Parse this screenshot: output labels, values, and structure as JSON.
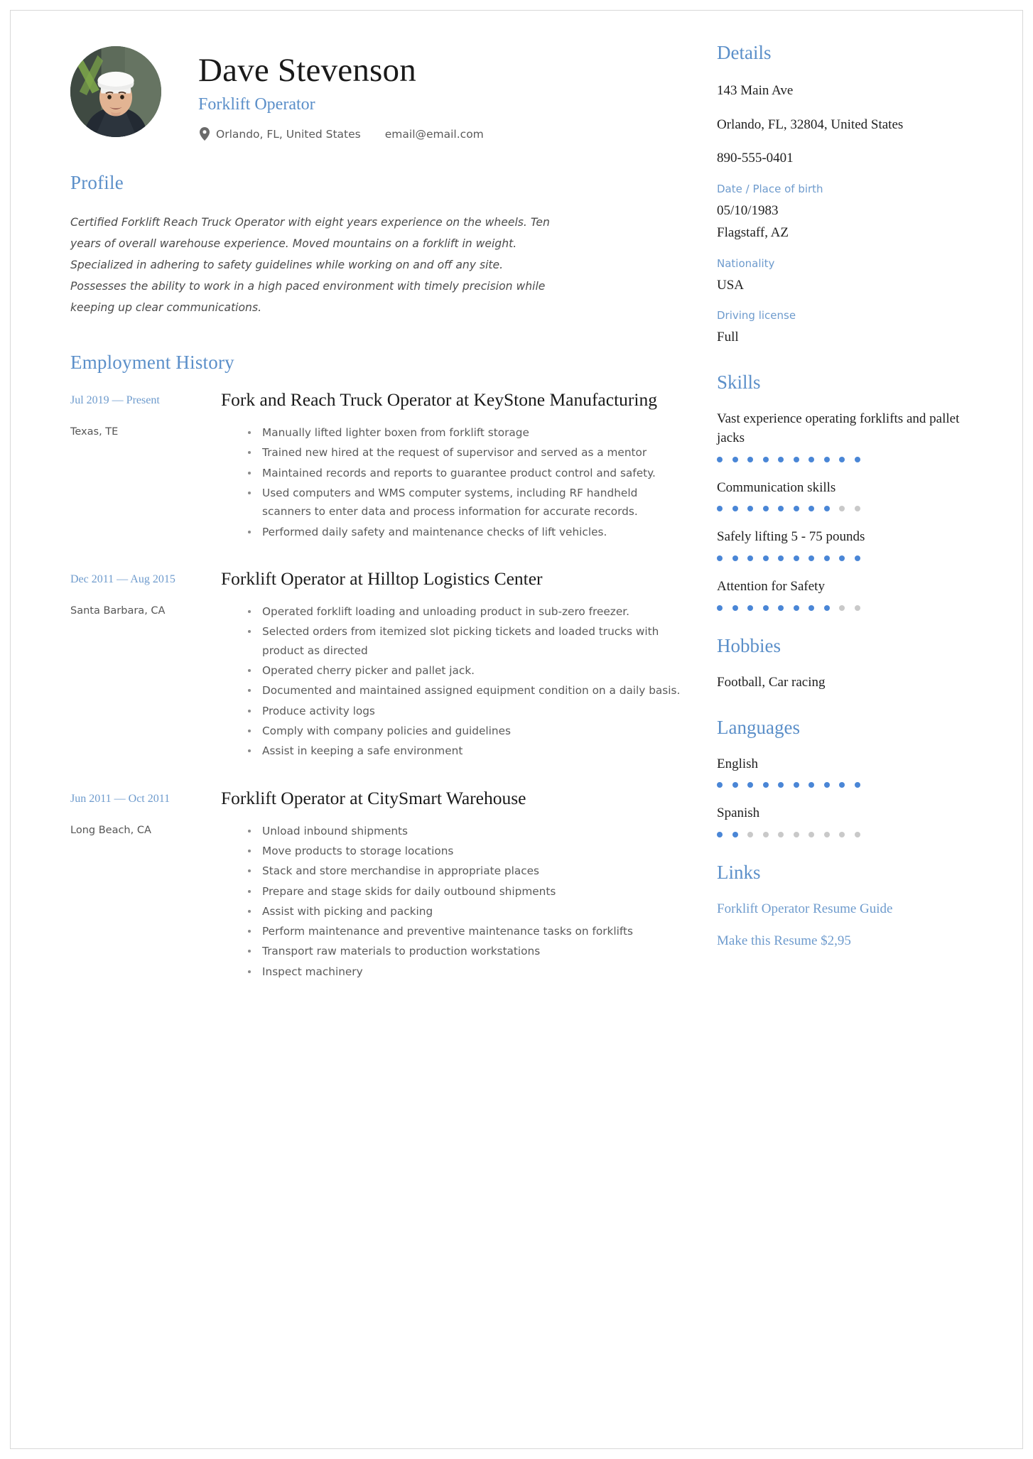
{
  "header": {
    "full_name": "Dave Stevenson",
    "job_title": "Forklift Operator",
    "location": "Orlando, FL, United States",
    "email": "email@email.com",
    "location_icon": "map-pin-icon",
    "avatar_alt": "portrait-photo"
  },
  "profile": {
    "heading": "Profile",
    "text": "Certified Forklift Reach Truck Operator with eight years experience on the wheels. Ten years of overall warehouse experience. Moved mountains on a forklift in weight. Specialized in adhering to safety guidelines while working on and off any site. Possesses the ability to work in a high paced environment with timely precision while keeping up clear communications."
  },
  "employment": {
    "heading": "Employment History",
    "jobs": [
      {
        "dates": "Jul 2019 — Present",
        "place": "Texas, TE",
        "role": "Fork and Reach Truck Operator at  KeyStone Manufacturing",
        "bullets": [
          "Manually lifted lighter boxen from forklift storage",
          "Trained new hired at the request of supervisor and served as a mentor",
          "Maintained records and reports to guarantee product control and safety.",
          "Used computers and WMS computer systems, including RF handheld scanners to enter data and process information for accurate records.",
          "Performed daily safety and maintenance checks of lift vehicles."
        ]
      },
      {
        "dates": "Dec 2011 — Aug 2015",
        "place": "Santa Barbara, CA",
        "role": "Forklift Operator at  Hilltop Logistics Center",
        "bullets": [
          "Operated forklift loading and unloading product in sub-zero freezer.",
          "Selected orders from itemized slot picking tickets and loaded trucks with product as directed",
          "Operated cherry picker and pallet jack.",
          "Documented and maintained assigned equipment condition on a daily basis.",
          "Produce activity logs",
          "Comply with company policies and guidelines",
          "Assist in keeping a safe environment"
        ]
      },
      {
        "dates": "Jun 2011 — Oct 2011",
        "place": "Long Beach, CA",
        "role": "Forklift Operator at  CitySmart Warehouse",
        "bullets": [
          "Unload inbound shipments",
          "Move products to storage locations",
          "Stack and store merchandise in appropriate places",
          "Prepare and stage skids for daily outbound shipments",
          "Assist with picking and packing",
          "Perform maintenance and preventive maintenance tasks on forklifts",
          "Transport raw materials to production workstations",
          "Inspect machinery"
        ]
      }
    ]
  },
  "details": {
    "heading": "Details",
    "address": "143 Main Ave",
    "city_line": "Orlando, FL, 32804, United States",
    "phone": "890-555-0401",
    "birth_label": "Date / Place of birth",
    "birth_value": "05/10/1983 Flagstaff, AZ",
    "birth_date": "05/10/1983",
    "birth_place": "Flagstaff, AZ",
    "nationality_label": "Nationality",
    "nationality_value": "USA",
    "license_label": "Driving license",
    "license_value": "Full"
  },
  "skills": {
    "heading": "Skills",
    "max_dots": 10,
    "items": [
      {
        "name": "Vast experience operating forklifts and pallet jacks",
        "rating": 10
      },
      {
        "name": "Communication skills",
        "rating": 8
      },
      {
        "name": "Safely lifting 5 - 75 pounds",
        "rating": 10
      },
      {
        "name": "Attention for Safety",
        "rating": 8
      }
    ]
  },
  "hobbies": {
    "heading": "Hobbies",
    "value": "Football, Car racing"
  },
  "languages": {
    "heading": "Languages",
    "max_dots": 10,
    "items": [
      {
        "name": "English",
        "rating": 10
      },
      {
        "name": "Spanish",
        "rating": 2
      }
    ]
  },
  "links": {
    "heading": "Links",
    "items": [
      "Forklift Operator Resume Guide",
      "Make this Resume $2,95"
    ]
  },
  "colors": {
    "accent": "#5b8fc9",
    "accent_light": "#6e9bcd",
    "dot_on": "#4a86d6",
    "dot_off": "#c9c9c9",
    "body_text": "#5a5a5a",
    "heading_text": "#1a1a1a"
  }
}
